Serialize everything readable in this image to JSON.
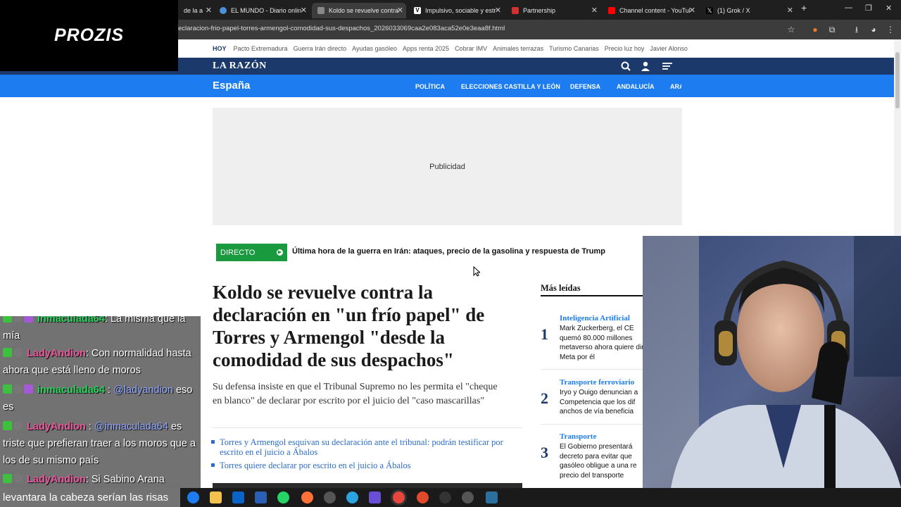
{
  "browser": {
    "tabs": [
      {
        "title": "de la a",
        "color": "#c0392b"
      },
      {
        "title": "EL MUNDO - Diario onlin",
        "color": "#4a90d9"
      },
      {
        "title": "Koldo se revuelve contra",
        "color": "#888888",
        "active": true
      },
      {
        "title": "Impulsivo, sociable y estr",
        "color": "#ffffff"
      },
      {
        "title": "Partnership",
        "color": "#d63031"
      },
      {
        "title": "Channel content - YouTul",
        "color": "#ff0000"
      },
      {
        "title": "(1) Grok / X",
        "color": "#000000"
      }
    ],
    "url": "eclaracion-frio-papel-torres-armengol-comodidad-sus-despachos_2026033069caa2e083aca52e0e3eaa8f.html"
  },
  "overlay": {
    "sponsor_logo": "PROZIS",
    "chat": [
      {
        "user": "inmaculada64",
        "color": "u1",
        "text": ": La misma que la mía",
        "mention": ""
      },
      {
        "user": "LadyAndion",
        "color": "u2",
        "text": ": Con normalidad hasta ahora que está lleno de moros",
        "mention": ""
      },
      {
        "user": "inmaculada64",
        "color": "u1",
        "text": " :",
        "mention": "@ladyandion",
        "after": " eso es"
      },
      {
        "user": "LadyAndion",
        "color": "u2",
        "text": " :",
        "mention": "@inmaculada64",
        "after": " es triste que prefieran traer a los moros que a los de su mismo país"
      },
      {
        "user": "LadyAndion",
        "color": "u2",
        "text": ": Si Sabino Arana",
        "mention": ""
      }
    ],
    "caption": "levantara la cabeza serían las risas"
  },
  "site": {
    "hoy_label": "HOY",
    "trending": [
      "Pacto Extremadura",
      "Guerra Irán directo",
      "Ayudas gasóleo",
      "Apps renta 2025",
      "Cobrar IMV",
      "Animales terrazas",
      "Turismo Canarias",
      "Precio luz hoy",
      "Javier Alonso"
    ],
    "logo": "LA RAZÓN",
    "section": "España",
    "nav": [
      "POLÍTICA",
      "ELECCIONES CASTILLA Y LEÓN",
      "DEFENSA",
      "ANDALUCÍA",
      "ARA"
    ],
    "ad_label": "Publicidad",
    "live_label": "DIRECTO",
    "live_text": "Última hora de la guerra en Irán: ataques, precio de la gasolina y respuesta de Trump",
    "headline": "Koldo se revuelve contra la declaración en \"un frío papel\" de Torres y Armengol \"desde la comodidad de sus despachos\"",
    "subtitle": "Su defensa insiste en que el Tribunal Supremo no les permita el \"cheque en blanco\" de declarar por escrito por el juicio del \"caso mascarillas\"",
    "related": [
      "Torres y Armengol esquivan su declaración ante el tribunal: podrán testificar por escrito en el juicio a Ábalos",
      "Torres quiere declarar por escrito en el juicio a Ábalos"
    ],
    "most_read_title": "Más leídas",
    "most_read": [
      {
        "num": "1",
        "category": "Inteligencia Artificial",
        "title": "Mark Zuckerberg, el CE quemó 80.000 millones metaverso ahora quiere dirija Meta por él"
      },
      {
        "num": "2",
        "category": "Transporte ferroviario",
        "title": "Iryo y Ouigo denuncian a Competencia que los dif anchos de vía beneficia"
      },
      {
        "num": "3",
        "category": "Transporte",
        "title": "El Gobierno presentará decreto para evitar que gasóleo obligue a una re precio del transporte"
      }
    ]
  }
}
